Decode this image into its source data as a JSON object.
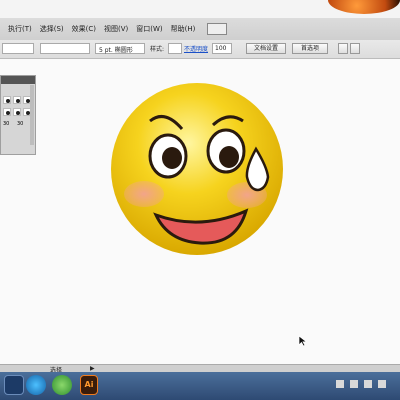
{
  "menubar": {
    "items": [
      "执行(T)",
      "选择(S)",
      "效果(C)",
      "视图(V)",
      "窗口(W)",
      "帮助(H)"
    ]
  },
  "controlbar": {
    "brush_label": "5 pt. 椭圆形",
    "style_label": "样式:",
    "opacity_value": "100",
    "opacity_link": "不透明度",
    "doc_setup_button": "文档设置",
    "preferences_button": "首选项"
  },
  "brush_panel": {
    "sizes": [
      "30",
      "30"
    ]
  },
  "statusbar": {
    "tool_label": "选择"
  },
  "taskbar": {
    "ai_label": "Ai"
  },
  "colors": {
    "face": "#f6d31e",
    "face_shadow": "#d9a800",
    "outline": "#2a1a0e",
    "cheek": "#f2a48a",
    "mouth": "#e55a5a",
    "drop": "#ffffff"
  },
  "icons": [
    "cursor-icon",
    "photoshop-icon",
    "illustrator-icon",
    "sogou-icon",
    "browser-icon"
  ]
}
